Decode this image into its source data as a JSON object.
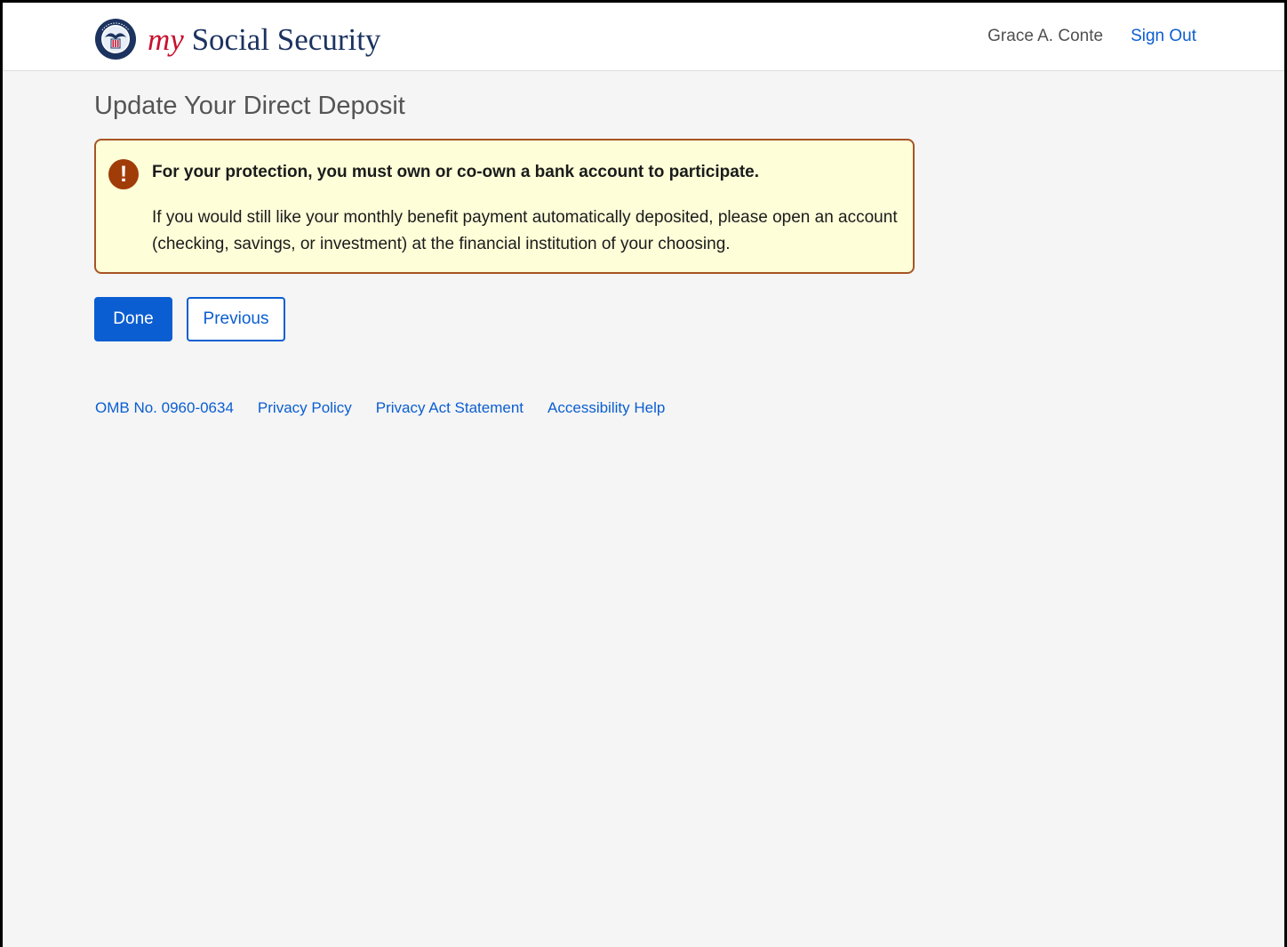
{
  "header": {
    "brand_my": "my",
    "brand_rest": "Social Security",
    "user_name": "Grace A. Conte",
    "sign_out": "Sign Out"
  },
  "page": {
    "title": "Update Your Direct Deposit"
  },
  "alert": {
    "icon_glyph": "!",
    "heading": "For your protection, you must own or co-own a bank account to participate.",
    "body": "If you would still like your monthly benefit payment automatically deposited, please open an account (checking, savings, or investment) at the financial institution of your choosing."
  },
  "actions": {
    "done": "Done",
    "previous": "Previous"
  },
  "footer": {
    "links": [
      "OMB No. 0960-0634",
      "Privacy Policy",
      "Privacy Act Statement",
      "Accessibility Help"
    ]
  },
  "colors": {
    "brand_navy": "#1c3360",
    "brand_red": "#c8102e",
    "link_blue": "#0b5ed1",
    "alert_bg": "#fefed9",
    "alert_border": "#a65424",
    "alert_icon": "#a03c08",
    "page_bg": "#f5f5f5"
  }
}
